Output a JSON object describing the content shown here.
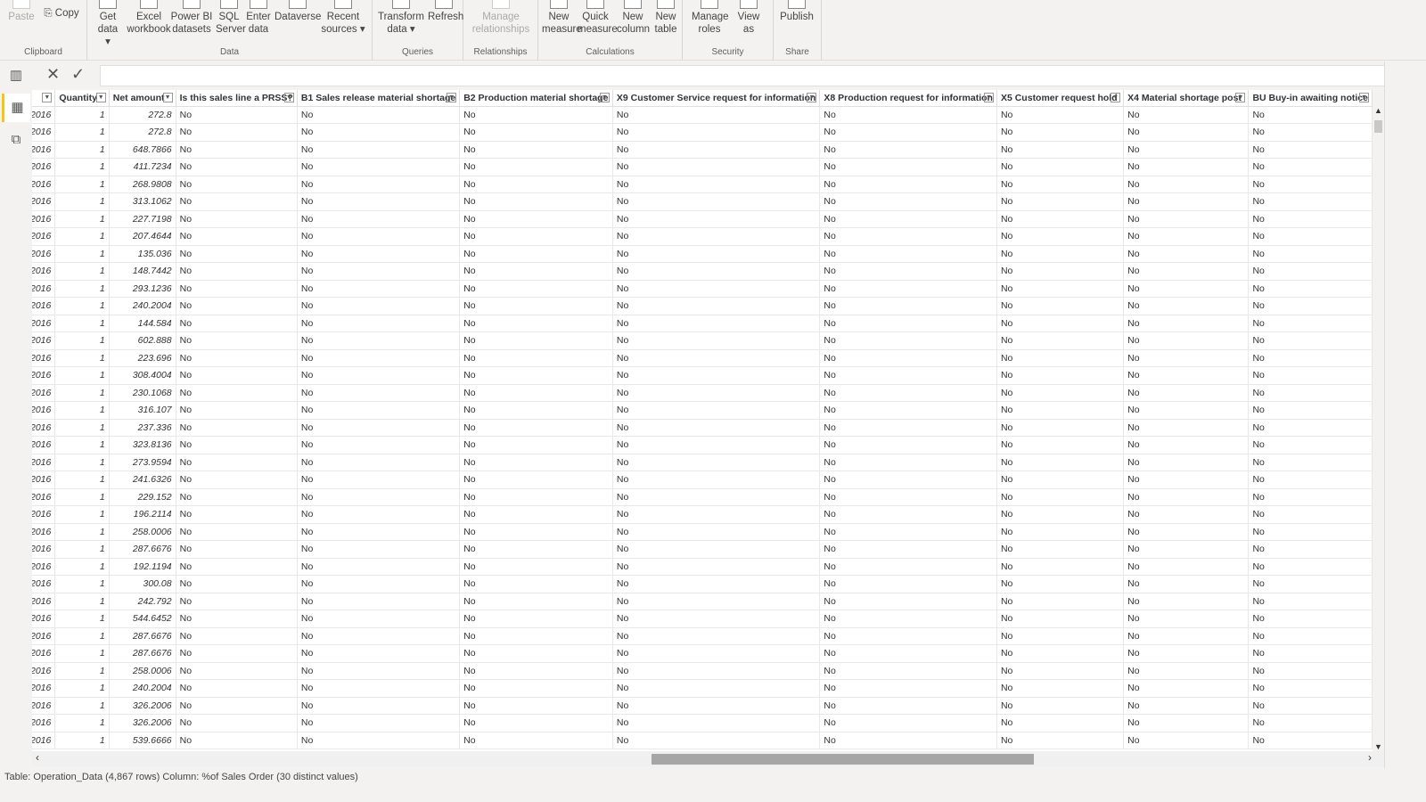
{
  "ribbon": {
    "groups": [
      {
        "label": "Clipboard",
        "buttons": [
          {
            "label": "Paste",
            "disabled": true
          },
          {
            "label": "Copy"
          }
        ]
      },
      {
        "label": "Data",
        "buttons": [
          {
            "label": "Get data ▾"
          },
          {
            "label": "Excel workbook"
          },
          {
            "label": "Power BI datasets"
          },
          {
            "label": "SQL Server"
          },
          {
            "label": "Enter data"
          },
          {
            "label": "Dataverse"
          },
          {
            "label": "Recent sources ▾"
          }
        ]
      },
      {
        "label": "Queries",
        "buttons": [
          {
            "label": "Transform data ▾"
          },
          {
            "label": "Refresh"
          }
        ]
      },
      {
        "label": "Relationships",
        "buttons": [
          {
            "label": "Manage relationships",
            "disabled": true
          }
        ]
      },
      {
        "label": "Calculations",
        "buttons": [
          {
            "label": "New measure"
          },
          {
            "label": "Quick measure"
          },
          {
            "label": "New column"
          },
          {
            "label": "New table"
          }
        ]
      },
      {
        "label": "Security",
        "buttons": [
          {
            "label": "Manage roles"
          },
          {
            "label": "View as"
          }
        ]
      },
      {
        "label": "Share",
        "buttons": [
          {
            "label": "Publish"
          }
        ]
      }
    ]
  },
  "formula": {
    "cancel_icon": "close-icon",
    "commit_icon": "check-icon"
  },
  "nav": [
    {
      "name": "report-view",
      "icon": "bar-chart-icon"
    },
    {
      "name": "data-view",
      "icon": "table-icon",
      "active": true
    },
    {
      "name": "model-view",
      "icon": "model-icon"
    }
  ],
  "table": {
    "columns": [
      "",
      "Quantity",
      "Net amount",
      "Is this sales line a PRSS?",
      "B1 Sales release material shortage",
      "B2 Production material shortage",
      "X9 Customer Service request for information",
      "X8 Production request for information",
      "X5 Customer request hold",
      "X4 Material shortage post",
      "BU Buy-in awaiting notice"
    ],
    "date_value": "2016",
    "quantity_value": "1",
    "flag_value": "No",
    "net_amounts": [
      "272.8",
      "272.8",
      "648.7866",
      "411.7234",
      "268.9808",
      "313.1062",
      "227.7198",
      "207.4644",
      "135.036",
      "148.7442",
      "293.1236",
      "240.2004",
      "144.584",
      "602.888",
      "223.696",
      "308.4004",
      "230.1068",
      "316.107",
      "237.336",
      "323.8136",
      "273.9594",
      "241.6326",
      "229.152",
      "196.2114",
      "258.0006",
      "287.6676",
      "192.1194",
      "300.08",
      "242.792",
      "544.6452",
      "287.6676",
      "287.6676",
      "258.0006",
      "240.2004",
      "326.2006",
      "326.2006",
      "539.6666"
    ]
  },
  "status": "Table: Operation_Data (4,867 rows) Column: %of Sales Order (30 distinct values)"
}
